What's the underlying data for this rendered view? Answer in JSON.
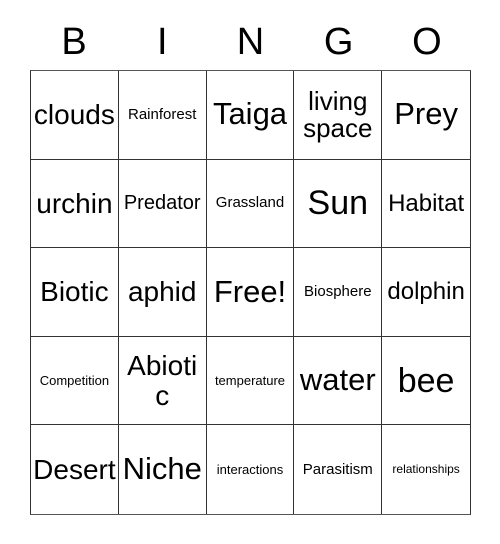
{
  "card": {
    "title": "Bingo Card",
    "header_letters": [
      "B",
      "I",
      "N",
      "G",
      "O"
    ],
    "free_space_label": "Free!",
    "rows": [
      [
        {
          "label": "clouds",
          "size": "lg"
        },
        {
          "label": "Rainforest",
          "size": "xs"
        },
        {
          "label": "Taiga",
          "size": "xl"
        },
        {
          "label": "living space",
          "size": "wrap"
        },
        {
          "label": "Prey",
          "size": "xl"
        }
      ],
      [
        {
          "label": "urchin",
          "size": "lg"
        },
        {
          "label": "Predator",
          "size": "sm"
        },
        {
          "label": "Grassland",
          "size": "xs"
        },
        {
          "label": "Sun",
          "size": "xxl"
        },
        {
          "label": "Habitat",
          "size": "md"
        }
      ],
      [
        {
          "label": "Biotic",
          "size": "lg"
        },
        {
          "label": "aphid",
          "size": "lg"
        },
        {
          "label": "Free!",
          "size": "xl"
        },
        {
          "label": "Biosphere",
          "size": "xs"
        },
        {
          "label": "dolphin",
          "size": "md"
        }
      ],
      [
        {
          "label": "Competition",
          "size": "xxs"
        },
        {
          "label": "Abiotic",
          "size": "lg"
        },
        {
          "label": "temperature",
          "size": "xxs"
        },
        {
          "label": "water",
          "size": "xl"
        },
        {
          "label": "bee",
          "size": "xxl"
        }
      ],
      [
        {
          "label": "Desert",
          "size": "lg"
        },
        {
          "label": "Niche",
          "size": "xl"
        },
        {
          "label": "interactions",
          "size": "xxs"
        },
        {
          "label": "Parasitism",
          "size": "xs"
        },
        {
          "label": "relationships",
          "size": "min"
        }
      ]
    ],
    "colors": {
      "background": "#ffffff",
      "text": "#000000",
      "grid_line": "#333333"
    }
  }
}
